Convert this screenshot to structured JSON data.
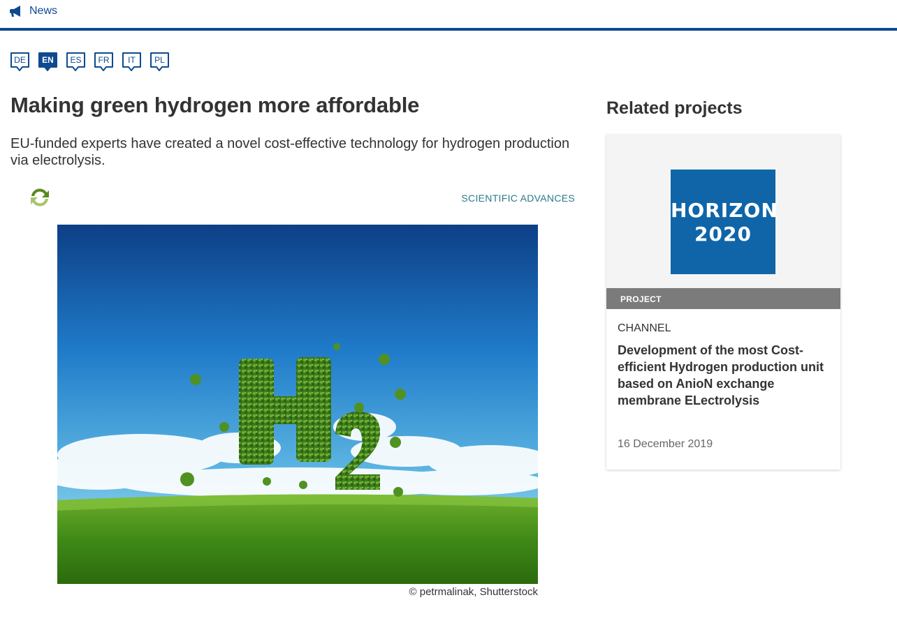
{
  "header": {
    "news_label": "News",
    "accent_color": "#0e4a8f"
  },
  "languages": [
    {
      "code": "DE",
      "active": false
    },
    {
      "code": "EN",
      "active": true
    },
    {
      "code": "ES",
      "active": false
    },
    {
      "code": "FR",
      "active": false
    },
    {
      "code": "IT",
      "active": false
    },
    {
      "code": "PL",
      "active": false
    }
  ],
  "article": {
    "title": "Making green hydrogen more affordable",
    "subtitle": "EU-funded experts have created a novel cost-effective technology for hydrogen production via electrolysis.",
    "category": "SCIENTIFIC ADVANCES",
    "image_credit": "© petrmalinak, Shutterstock"
  },
  "related": {
    "heading": "Related projects",
    "card": {
      "logo_line1": "HORIZON",
      "logo_line2": "2020",
      "logo_color": "#0f65a8",
      "tag": "PROJECT",
      "channel": "CHANNEL",
      "headline": "Development of the most Cost-efficient Hydrogen production unit based on AnioN exchange membrane ELectrolysis",
      "date": "16 December 2019"
    }
  }
}
